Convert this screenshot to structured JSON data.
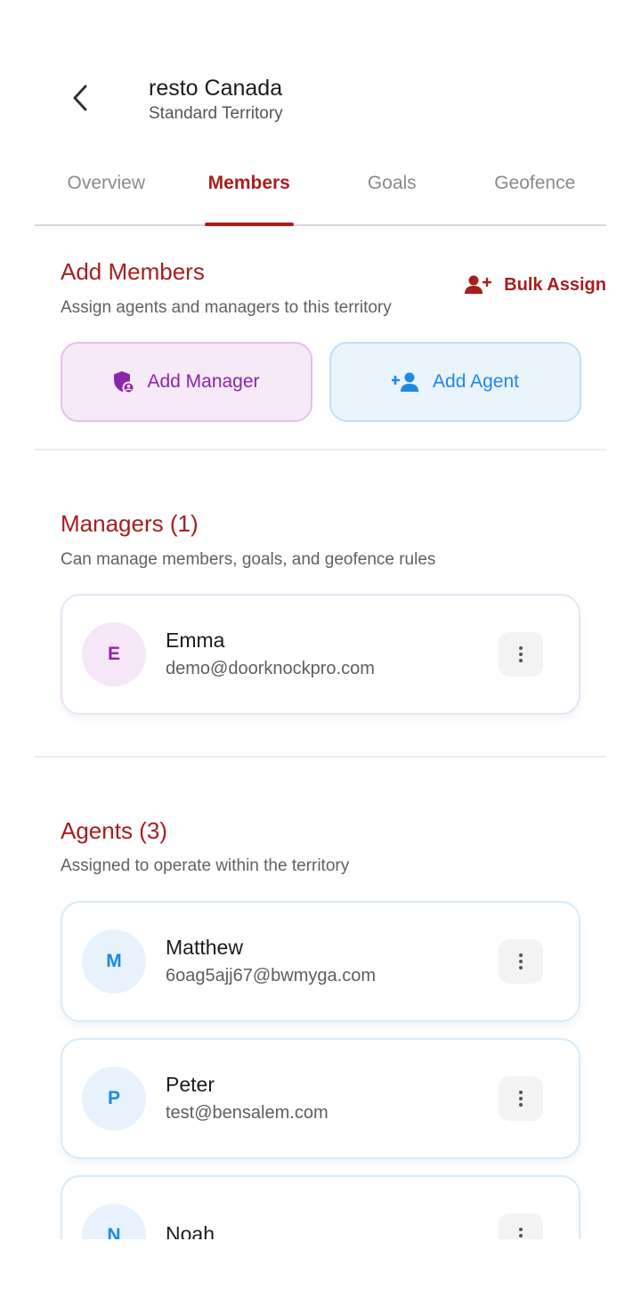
{
  "header": {
    "title": "resto Canada",
    "subtitle": "Standard Territory"
  },
  "tabs": [
    {
      "label": "Overview",
      "active": false
    },
    {
      "label": "Members",
      "active": true
    },
    {
      "label": "Goals",
      "active": false
    },
    {
      "label": "Geofence",
      "active": false
    }
  ],
  "add_members": {
    "title": "Add Members",
    "description": "Assign agents and managers to this territory",
    "bulk_assign_label": "Bulk Assign",
    "add_manager_label": "Add Manager",
    "add_agent_label": "Add Agent"
  },
  "managers": {
    "title": "Managers (1)",
    "description": "Can manage members, goals, and geofence rules",
    "items": [
      {
        "initial": "E",
        "name": "Emma",
        "email": "demo@doorknockpro.com"
      }
    ]
  },
  "agents": {
    "title": "Agents (3)",
    "description": "Assigned to operate within the territory",
    "items": [
      {
        "initial": "M",
        "name": "Matthew",
        "email": "6oag5ajj67@bwmyga.com"
      },
      {
        "initial": "P",
        "name": "Peter",
        "email": "test@bensalem.com"
      },
      {
        "initial": "N",
        "name": "Noah",
        "email": ""
      }
    ]
  },
  "colors": {
    "accent": "#a61e1e",
    "manager": "#8e24aa",
    "agent": "#1e88e5"
  },
  "icons": {
    "back": "chevron-left-icon",
    "bulk_assign": "person-add-icon",
    "add_manager": "shield-person-icon",
    "add_agent": "person-add-icon",
    "more": "more-vert-icon"
  }
}
